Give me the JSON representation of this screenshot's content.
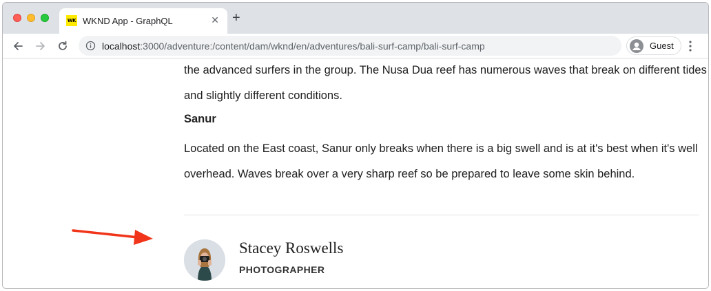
{
  "browser": {
    "tab": {
      "favicon_text": "WK",
      "title": "WKND App - GraphQL",
      "close_glyph": "✕"
    },
    "new_tab_glyph": "+",
    "url": {
      "host": "localhost",
      "rest": ":3000/adventure:/content/dam/wknd/en/adventures/bali-surf-camp/bali-surf-camp"
    },
    "profile_label": "Guest",
    "colors": {
      "tabstrip": "#dee1e6",
      "omnibox": "#f1f3f4",
      "favicon": "#ffea00"
    }
  },
  "article": {
    "para1": "the advanced surfers in the group. The Nusa Dua reef has numerous waves that break on different tides and slightly different conditions.",
    "heading": "Sanur",
    "para2": "Located on the East coast, Sanur only breaks when there is a big swell and is at it's best when it's well overhead. Waves break over a very sharp reef so be prepared to leave some skin behind."
  },
  "author": {
    "name": "Stacey Roswells",
    "role": "PHOTOGRAPHER"
  },
  "annotation": {
    "arrow_color": "#f0351a"
  }
}
